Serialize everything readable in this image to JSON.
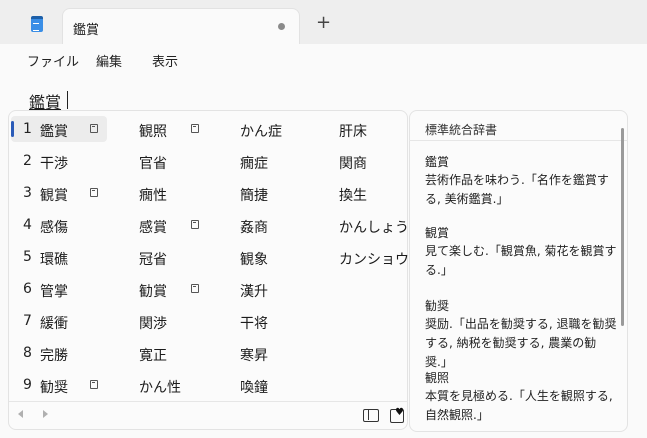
{
  "window": {
    "tab_title": "鑑賞",
    "new_tab_symbol": "+"
  },
  "menu": [
    "ファイル",
    "編集",
    "表示"
  ],
  "document": {
    "text": "鑑賞"
  },
  "candidates": {
    "col1": [
      {
        "num": "1",
        "text": "鑑賞",
        "memo": true
      },
      {
        "num": "2",
        "text": "干渉",
        "memo": false
      },
      {
        "num": "3",
        "text": "観賞",
        "memo": true
      },
      {
        "num": "4",
        "text": "感傷",
        "memo": false
      },
      {
        "num": "5",
        "text": "環礁",
        "memo": false
      },
      {
        "num": "6",
        "text": "管掌",
        "memo": false
      },
      {
        "num": "7",
        "text": "緩衝",
        "memo": false
      },
      {
        "num": "8",
        "text": "完勝",
        "memo": false
      },
      {
        "num": "9",
        "text": "勧奨",
        "memo": true
      }
    ],
    "col2": [
      {
        "text": "観照",
        "memo": true
      },
      {
        "text": "官省",
        "memo": false
      },
      {
        "text": "癇性",
        "memo": false
      },
      {
        "text": "感賞",
        "memo": true
      },
      {
        "text": "冠省",
        "memo": false
      },
      {
        "text": "勧賞",
        "memo": true
      },
      {
        "text": "関渉",
        "memo": false
      },
      {
        "text": "寛正",
        "memo": false
      },
      {
        "text": "かん性",
        "memo": false
      }
    ],
    "col3": [
      "かん症",
      "癇症",
      "簡捷",
      "姦商",
      "観象",
      "漢升",
      "干将",
      "寒昇",
      "喚鐘"
    ],
    "col4": [
      "肝床",
      "関商",
      "換生",
      "かんしょう",
      "カンショウ"
    ]
  },
  "dictionary": {
    "title": "標準統合辞書",
    "entries": [
      {
        "head": "鑑賞",
        "lines": [
          "芸術作品を味わう.「名作を鑑賞す",
          "る, 美術鑑賞.」"
        ]
      },
      {
        "head": "観賞",
        "lines": [
          "見て楽しむ.「観賞魚, 菊花を観賞す",
          "る.」"
        ]
      },
      {
        "head": "勧奨",
        "lines": [
          "奨励.「出品を勧奨する, 退職を勧奨",
          "する, 納税を勧奨する, 農業の勧奨.」"
        ]
      },
      {
        "head": "観照",
        "lines": [
          "本質を見極める.「人生を観照する,",
          "自然観照.」"
        ]
      }
    ]
  },
  "icons": {
    "memo": "memo-icon",
    "prev": "arrow-left-icon",
    "next": "arrow-right-icon",
    "box": "panel-toggle-icon",
    "note": "favorite-note-icon"
  }
}
